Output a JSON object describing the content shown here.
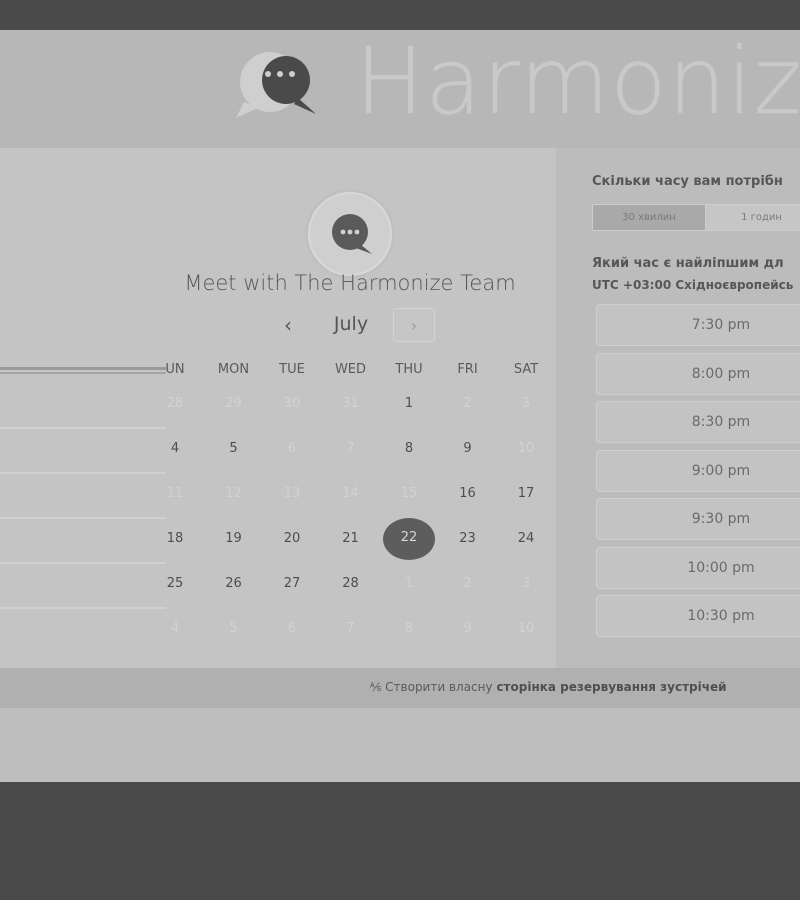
{
  "header": {
    "brand_name": "Harmonize",
    "logo_icon": "chat-bubble-logo-icon"
  },
  "calendar": {
    "title": "Meet with The Harmonize Team",
    "month": "July",
    "prev_label": "‹",
    "next_label": "›",
    "weekdays": [
      "UN",
      "MON",
      "TUE",
      "WED",
      "THU",
      "FRI",
      "SAT"
    ],
    "weeks": [
      [
        {
          "d": "28",
          "a": false
        },
        {
          "d": "29",
          "a": false
        },
        {
          "d": "30",
          "a": false
        },
        {
          "d": "31",
          "a": false
        },
        {
          "d": "1",
          "a": true
        },
        {
          "d": "2",
          "a": false
        },
        {
          "d": "3",
          "a": false
        }
      ],
      [
        {
          "d": "4",
          "a": true
        },
        {
          "d": "5",
          "a": true
        },
        {
          "d": "6",
          "a": false
        },
        {
          "d": "7",
          "a": false
        },
        {
          "d": "8",
          "a": true
        },
        {
          "d": "9",
          "a": true
        },
        {
          "d": "10",
          "a": false
        }
      ],
      [
        {
          "d": "11",
          "a": false
        },
        {
          "d": "12",
          "a": false
        },
        {
          "d": "13",
          "a": false
        },
        {
          "d": "14",
          "a": false
        },
        {
          "d": "15",
          "a": false
        },
        {
          "d": "16",
          "a": true
        },
        {
          "d": "17",
          "a": true
        }
      ],
      [
        {
          "d": "18",
          "a": true
        },
        {
          "d": "19",
          "a": true
        },
        {
          "d": "20",
          "a": true
        },
        {
          "d": "21",
          "a": true
        },
        {
          "d": "22",
          "a": true,
          "selected": true
        },
        {
          "d": "23",
          "a": true
        },
        {
          "d": "24",
          "a": true
        }
      ],
      [
        {
          "d": "25",
          "a": true
        },
        {
          "d": "26",
          "a": true
        },
        {
          "d": "27",
          "a": true
        },
        {
          "d": "28",
          "a": true
        },
        {
          "d": "1",
          "a": false
        },
        {
          "d": "2",
          "a": false
        },
        {
          "d": "3",
          "a": false
        }
      ],
      [
        {
          "d": "4",
          "a": false
        },
        {
          "d": "5",
          "a": false
        },
        {
          "d": "6",
          "a": false
        },
        {
          "d": "7",
          "a": false
        },
        {
          "d": "8",
          "a": false
        },
        {
          "d": "9",
          "a": false
        },
        {
          "d": "10",
          "a": false
        }
      ]
    ],
    "selected_day": "22"
  },
  "scheduler": {
    "duration_question": "Скільки часу вам потрібн",
    "durations": [
      "30 хвилин",
      "1 годин"
    ],
    "selected_duration": "30 хвилин",
    "time_question": "Який час є найліпшим дл",
    "timezone": "UTC +03:00 Східноєвропейсь",
    "slots": [
      "7:30 pm",
      "8:00 pm",
      "8:30 pm",
      "9:00 pm",
      "9:30 pm",
      "10:00 pm",
      "10:30 pm"
    ]
  },
  "footer": {
    "link_icon": "hubspot-sprocket-icon",
    "link_prefix": "Створити власну",
    "link_bold": "сторінка резервування зустрічей"
  },
  "colors": {
    "background": "#4a4a4a",
    "selected_day": "#5d5d5d"
  }
}
